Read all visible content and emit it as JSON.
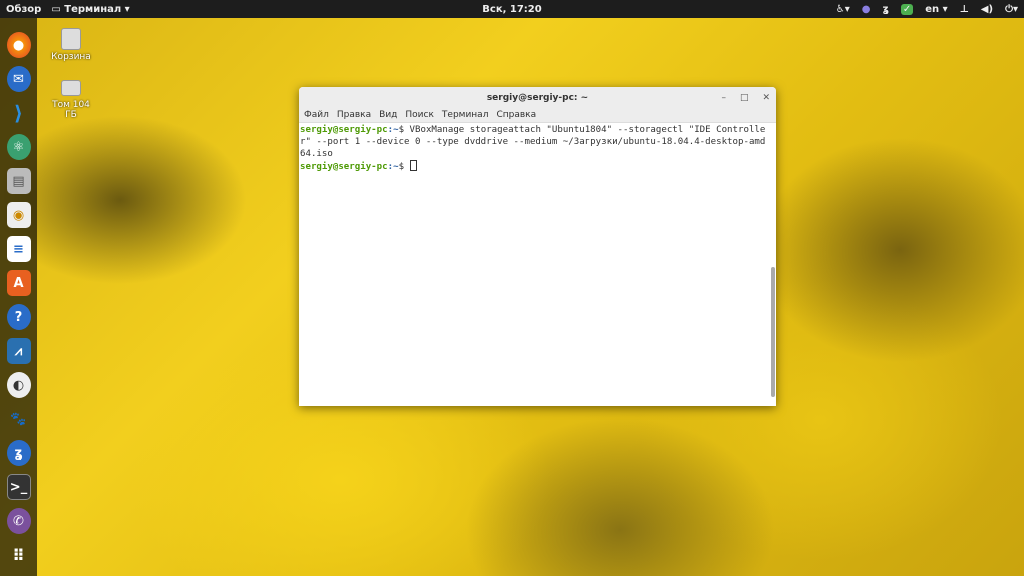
{
  "topbar": {
    "activities": "Обзор",
    "app": "Терминал ▾",
    "clock": "Вск, 17:20",
    "lang": "en ▾",
    "accent": "#1d1d1d"
  },
  "desktop": {
    "trash": "Корзина",
    "volume": "Том 104 ГБ"
  },
  "dock": [
    "firefox-icon",
    "thunderbird-icon",
    "vscode-icon",
    "atom-icon",
    "files-icon",
    "rhythmbox-icon",
    "writer-icon",
    "software-icon",
    "help-icon",
    "system-monitor-icon",
    "inkscape-icon",
    "gimp-icon",
    "app-icon",
    "terminal-icon",
    "viber-icon",
    "apps-grid-icon"
  ],
  "window": {
    "title": "sergiy@sergiy-pc: ~",
    "menu": [
      "Файл",
      "Правка",
      "Вид",
      "Поиск",
      "Терминал",
      "Справка"
    ],
    "prompt_user": "sergiy@sergiy-pc",
    "prompt_path": ":~",
    "prompt_sym": "$ ",
    "command": "VBoxManage storageattach \"Ubuntu1804\" --storagectl \"IDE Controller\" --port 1 --device 0 --type dvddrive --medium ~/Загрузки/ubuntu-18.04.4-desktop-amd64.iso"
  }
}
